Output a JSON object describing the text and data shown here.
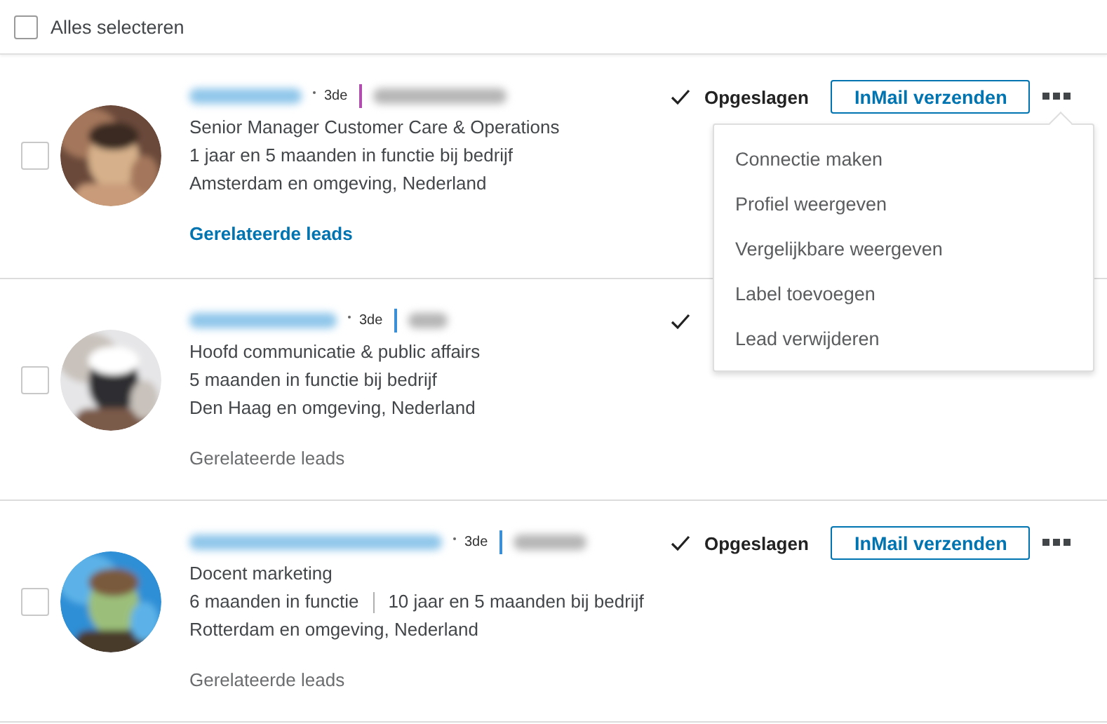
{
  "select_all": {
    "label": "Alles selecteren",
    "checked": false
  },
  "leads": [
    {
      "checked": false,
      "degree": "3de",
      "color": "#b24db0",
      "title": "Senior Manager Customer Care & Operations",
      "tenure": [
        "1 jaar en 5 maanden in functie bij bedrijf"
      ],
      "location": "Amsterdam en omgeving, Nederland",
      "related": {
        "label": "Gerelateerde leads",
        "highlighted": true
      },
      "saved": true,
      "saved_label": "Opgeslagen",
      "inmail": {
        "label": "InMail verzenden"
      },
      "more": true
    },
    {
      "checked": false,
      "degree": "3de",
      "color": "#3b8fd6",
      "title": "Hoofd communicatie & public affairs",
      "tenure": [
        "5 maanden in functie bij bedrijf"
      ],
      "location": "Den Haag en omgeving, Nederland",
      "related": {
        "label": "Gerelateerde leads",
        "highlighted": false
      },
      "saved": true,
      "more": false
    },
    {
      "checked": false,
      "degree": "3de",
      "color": "#3b8fd6",
      "title": "Docent marketing",
      "tenure": [
        "6 maanden in functie",
        "10 jaar en 5 maanden bij bedrijf"
      ],
      "location": "Rotterdam en omgeving, Nederland",
      "related": {
        "label": "Gerelateerde leads",
        "highlighted": false
      },
      "saved": true,
      "saved_label": "Opgeslagen",
      "inmail": {
        "label": "InMail verzenden"
      },
      "more": true
    }
  ],
  "menu": {
    "items": [
      "Connectie maken",
      "Profiel weergeven",
      "Vergelijkbare weergeven",
      "Label toevoegen",
      "Lead verwijderen"
    ]
  }
}
